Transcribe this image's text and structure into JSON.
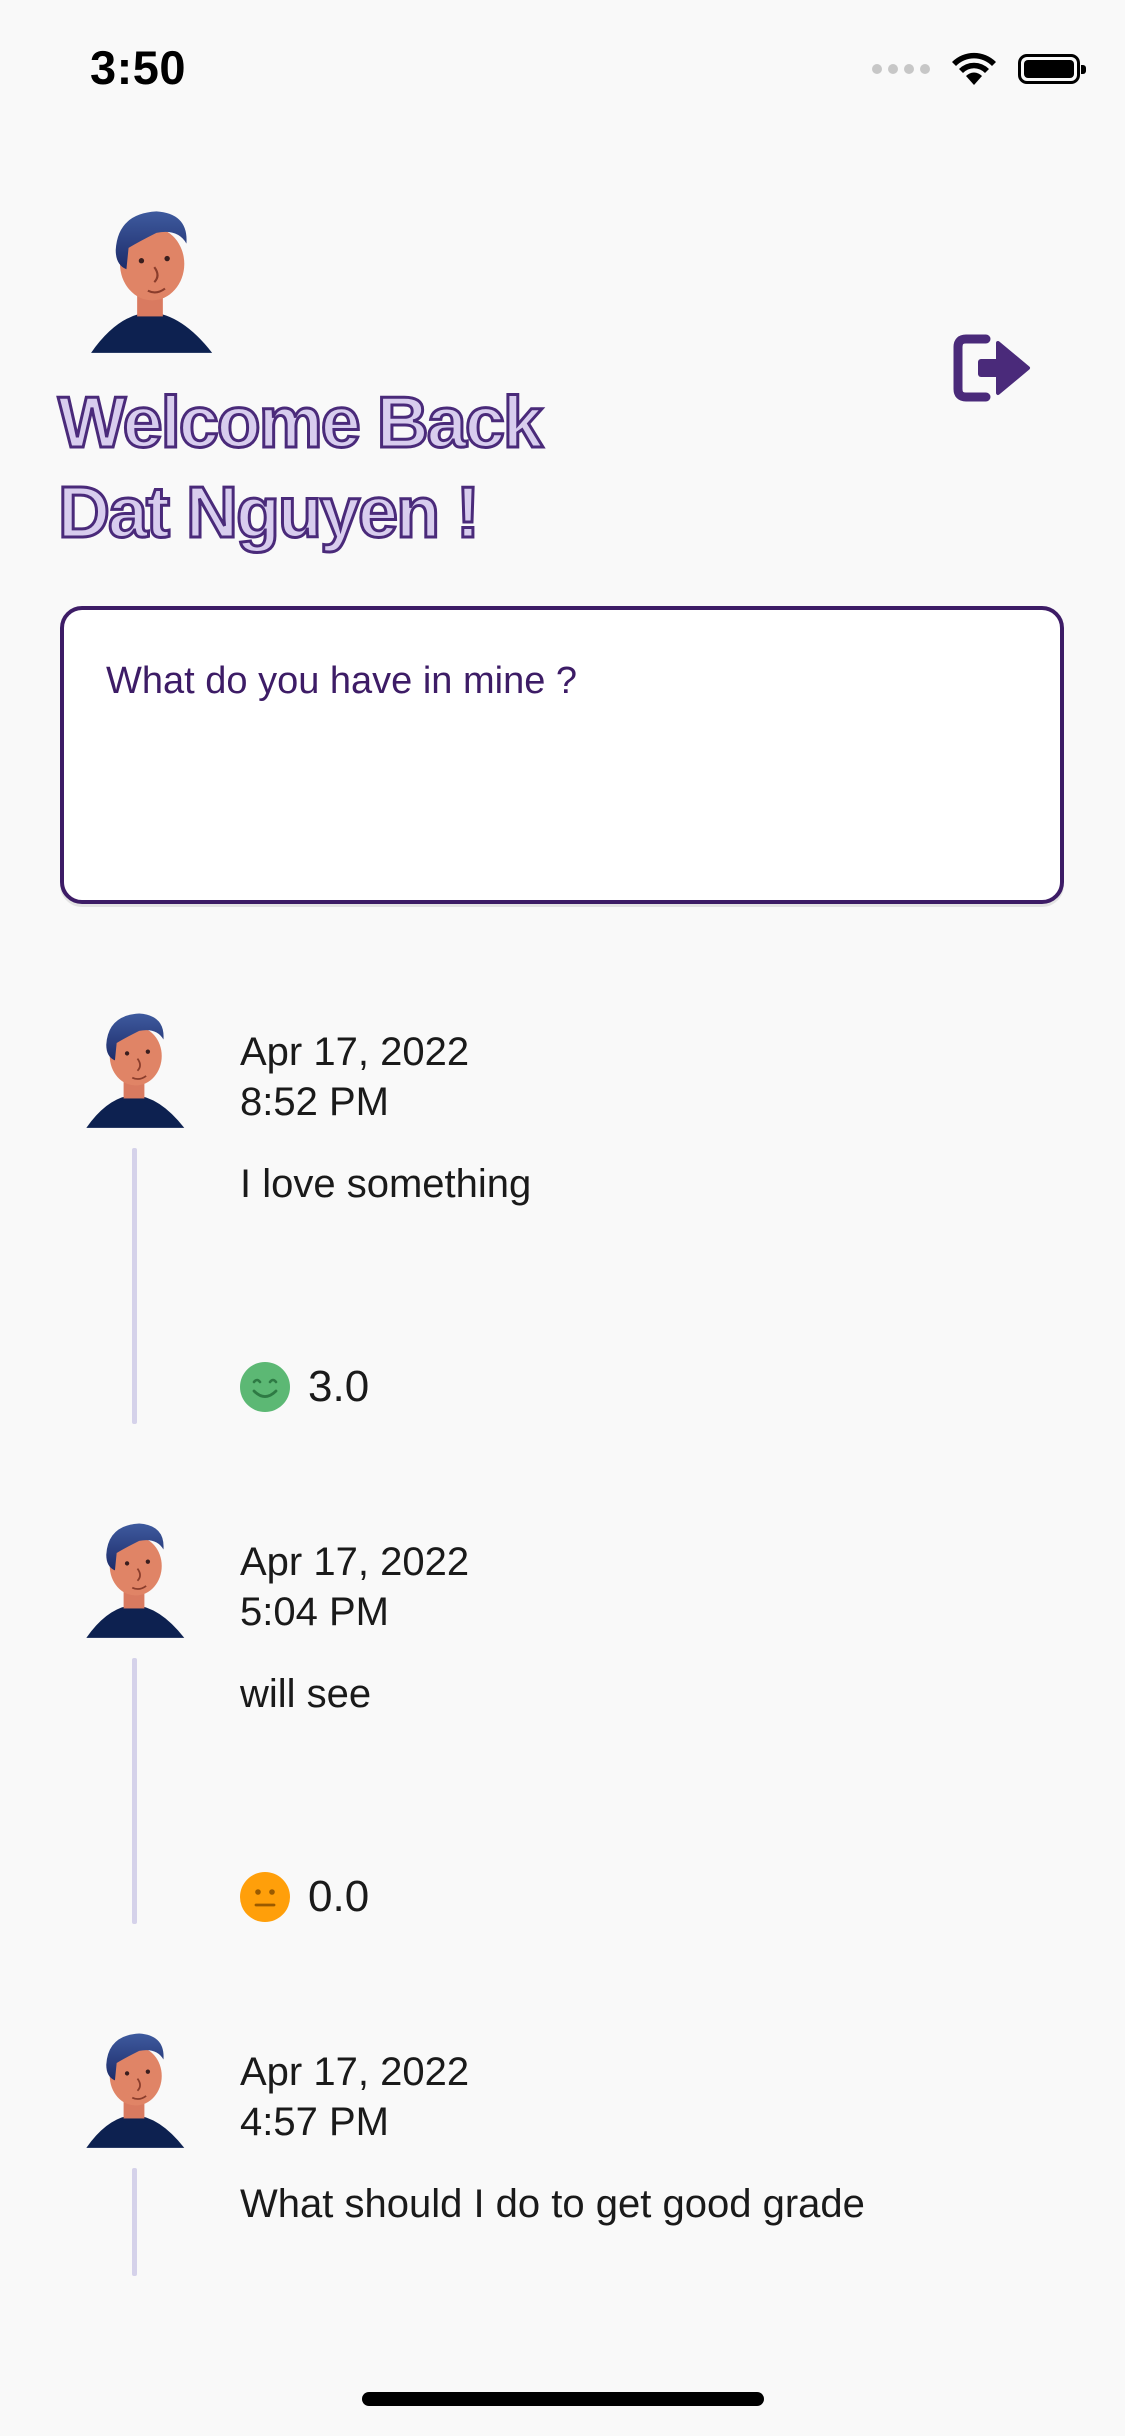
{
  "status_bar": {
    "time": "3:50",
    "icons": [
      "signal-icon",
      "wifi-icon",
      "battery-icon"
    ]
  },
  "header": {
    "welcome_line1": "Welcome Back",
    "welcome_line2": "Dat Nguyen !",
    "logout_icon": "logout-icon"
  },
  "composer": {
    "placeholder": "What do you have in mine ?"
  },
  "colors": {
    "accent": "#3d1c66",
    "welcome_fill": "#d8cdee",
    "timeline": "#d5d2ea",
    "mood_happy": "#5cb874",
    "mood_neutral": "#ff9f0a"
  },
  "entries": [
    {
      "date": "Apr 17, 2022",
      "time": "8:52 PM",
      "text": "I love something",
      "mood": "happy",
      "score": "3.0"
    },
    {
      "date": "Apr 17, 2022",
      "time": "5:04 PM",
      "text": "will see",
      "mood": "neutral",
      "score": "0.0"
    },
    {
      "date": "Apr 17, 2022",
      "time": "4:57 PM",
      "text": "What should I do to get good grade",
      "mood": "",
      "score": ""
    }
  ]
}
